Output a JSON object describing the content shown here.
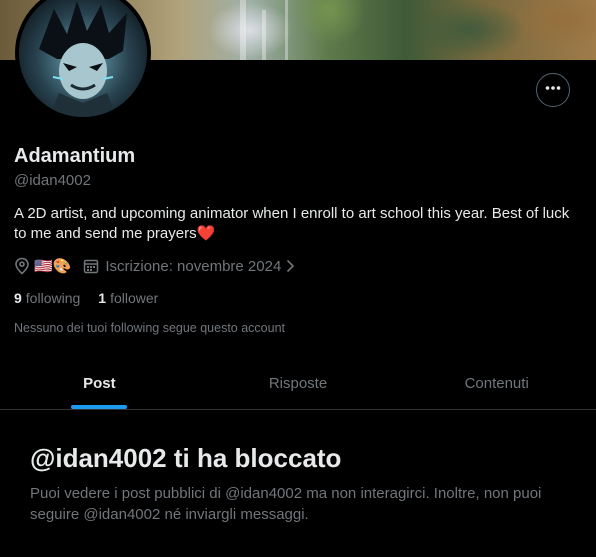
{
  "profile": {
    "name": "Adamantium",
    "handle": "@idan4002",
    "bio": "A 2D artist, and upcoming animator when I enroll to art school this year. Best of luck to me and send me prayers❤️",
    "location": "🇺🇸🎨",
    "joined": "Iscrizione: novembre 2024"
  },
  "stats": {
    "following_count": "9",
    "following_label": "following",
    "followers_count": "1",
    "followers_label": "follower"
  },
  "followers_note": "Nessuno dei tuoi following segue questo account",
  "tabs": [
    {
      "label": "Post",
      "active": true
    },
    {
      "label": "Risposte",
      "active": false
    },
    {
      "label": "Contenuti",
      "active": false
    }
  ],
  "blocked": {
    "title": "@idan4002 ti ha bloccato",
    "message": "Puoi vedere i post pubblici di @idan4002 ma non interagirci. Inoltre, non puoi seguire @idan4002 né inviargli messaggi."
  },
  "colors": {
    "background": "#000000",
    "text_primary": "#e7e9ea",
    "text_secondary": "#71767b",
    "accent": "#1d9bf0",
    "border": "#2f3336",
    "heart": "#f91880"
  },
  "icons": [
    "more-icon",
    "location-icon",
    "calendar-icon",
    "chevron-right-icon"
  ]
}
